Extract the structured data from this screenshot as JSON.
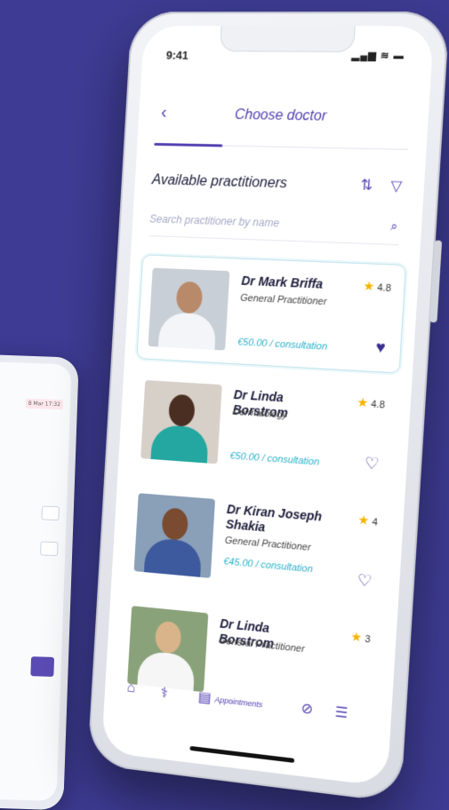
{
  "background_phone": {
    "date_text": "8 Mar 17:32"
  },
  "status_bar": {
    "time": "9:41",
    "icons": "signal-icon wifi-icon battery-icon"
  },
  "header": {
    "back_icon": "chevron-left-icon",
    "title": "Choose doctor"
  },
  "section": {
    "title": "Available practitioners",
    "sort_icon": "sort-icon",
    "filter_icon": "filter-icon"
  },
  "search": {
    "placeholder": "Search practitioner by name",
    "icon": "search-icon"
  },
  "doctors": [
    {
      "name": "Dr Mark Briffa",
      "specialty": "General Practitioner",
      "price": "€50.00 / consultation",
      "rating": "4.8",
      "favorite": true,
      "selected": true
    },
    {
      "name": "Dr Linda Borstrom",
      "specialty": "Dermatology",
      "price": "€50.00 / consultation",
      "rating": "4.8",
      "favorite": false,
      "selected": false
    },
    {
      "name": "Dr Kiran Joseph Shakia",
      "specialty": "General Practitioner",
      "price": "€45.00 / consultation",
      "rating": "4",
      "favorite": false,
      "selected": false
    },
    {
      "name": "Dr Linda Borstrom",
      "specialty": "General Practitioner",
      "price": "",
      "rating": "3",
      "favorite": false,
      "selected": false
    }
  ],
  "tabbar": {
    "appointments_label": "Appointments"
  },
  "colors": {
    "primary": "#5240b0",
    "accent": "#2bb0c8",
    "background": "#3d3b93",
    "star": "#f4b400"
  }
}
